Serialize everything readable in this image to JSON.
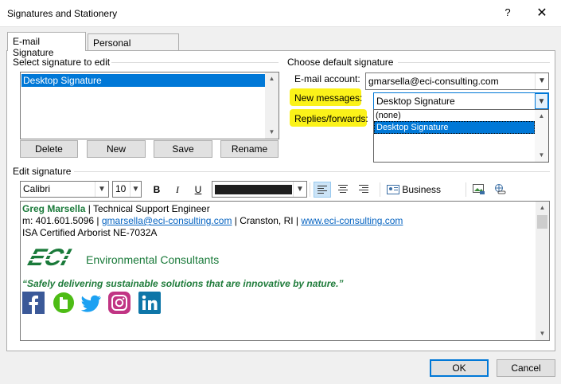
{
  "window": {
    "title": "Signatures and Stationery",
    "help_label": "?",
    "close_label": "✕"
  },
  "tabs": [
    {
      "label": "E-mail Signature",
      "active": true
    },
    {
      "label": "Personal Stationery",
      "active": false
    }
  ],
  "select_signature": {
    "label": "Select signature to edit",
    "items": [
      "Desktop Signature"
    ],
    "selected": "Desktop Signature"
  },
  "signature_buttons": {
    "delete": "Delete",
    "new": "New",
    "save": "Save",
    "rename": "Rename"
  },
  "default_signature": {
    "group_label": "Choose default signature",
    "email_account_label": "E-mail account:",
    "email_account_value": "gmarsella@eci-consulting.com",
    "new_messages_label": "New messages:",
    "new_messages_value": "Desktop Signature",
    "replies_label": "Replies/forwards:",
    "dropdown_options": [
      "(none)",
      "Desktop Signature"
    ],
    "dropdown_selected": "Desktop Signature",
    "highlight_color": "#fbf219"
  },
  "edit_signature": {
    "label": "Edit signature",
    "font_name": "Calibri",
    "font_size": "10",
    "bold_label": "B",
    "italic_label": "I",
    "underline_label": "U",
    "font_color": "#1f1f1f",
    "business_card_label": "Business Card",
    "active_alignment": "left"
  },
  "signature_content": {
    "name": "Greg Marsella",
    "title_sep": " | Technical Support Engineer",
    "phone_prefix": "m: 401.601.5096 | ",
    "email": "gmarsella@eci-consulting.com",
    "location": " | Cranston, RI | ",
    "website": "www.eci-consulting.com",
    "certification": "ISA Certified Arborist NE-7032A",
    "logo_text": "Environmental Consultants",
    "logo_mark": "ECI",
    "brand_color": "#1a7a3a",
    "tagline": "“Safely delivering sustainable solutions that are innovative by nature.”",
    "social_icons": [
      "facebook-icon",
      "houzz-icon",
      "twitter-icon",
      "instagram-icon",
      "linkedin-icon"
    ]
  },
  "footer": {
    "ok": "OK",
    "cancel": "Cancel"
  },
  "accent_color": "#0078d7"
}
